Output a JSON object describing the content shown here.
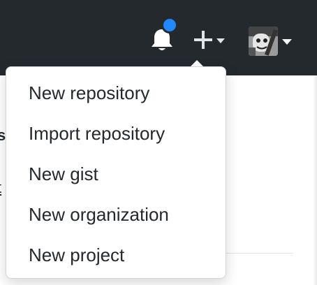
{
  "header": {
    "icons": {
      "notifications": "bell-icon",
      "create": "plus-icon",
      "avatar": "avatar"
    },
    "colors": {
      "bar_bg": "#24292e",
      "notification_dot": "#2188ff",
      "menu_text": "#24292e"
    }
  },
  "page_behind": {
    "fragment_1": "s",
    "fragment_2": "t"
  },
  "create_menu": {
    "items": [
      {
        "label": "New repository"
      },
      {
        "label": "Import repository"
      },
      {
        "label": "New gist"
      },
      {
        "label": "New organization"
      },
      {
        "label": "New project"
      }
    ]
  }
}
